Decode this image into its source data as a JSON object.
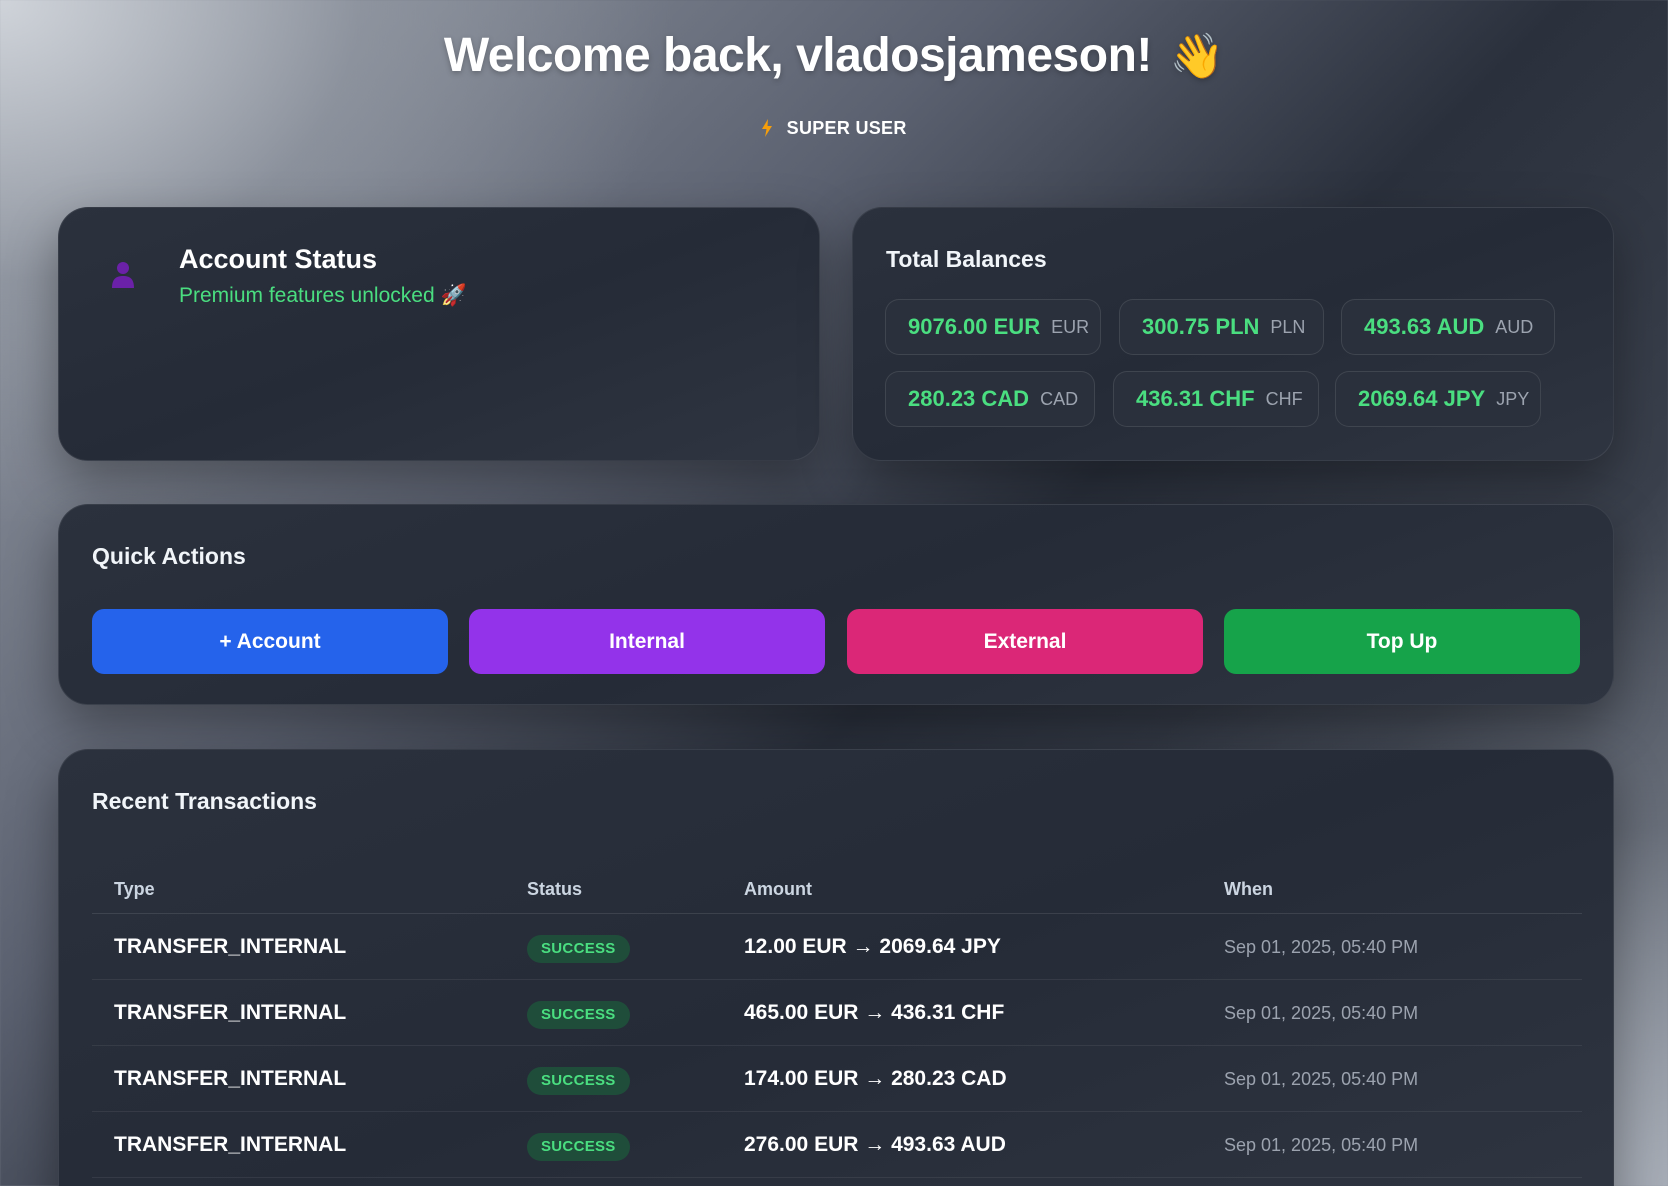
{
  "header": {
    "welcome": "Welcome back, vladosjameson!",
    "wave_emoji": "👋",
    "role_icon": "lightning-bolt-icon",
    "role": "SUPER USER"
  },
  "account_status": {
    "icon": "user-icon",
    "title": "Account Status",
    "subtitle": "Premium features unlocked 🚀"
  },
  "balances": {
    "title": "Total Balances",
    "items": [
      {
        "amount": "9076.00 EUR",
        "currency": "EUR"
      },
      {
        "amount": "300.75 PLN",
        "currency": "PLN"
      },
      {
        "amount": "493.63 AUD",
        "currency": "AUD"
      },
      {
        "amount": "280.23 CAD",
        "currency": "CAD"
      },
      {
        "amount": "436.31 CHF",
        "currency": "CHF"
      },
      {
        "amount": "2069.64 JPY",
        "currency": "JPY"
      }
    ]
  },
  "quick_actions": {
    "title": "Quick Actions",
    "buttons": [
      {
        "label": "+ Account",
        "color": "#2563eb"
      },
      {
        "label": "Internal",
        "color": "#9333ea"
      },
      {
        "label": "External",
        "color": "#db2777"
      },
      {
        "label": "Top Up",
        "color": "#16a34a"
      }
    ]
  },
  "transactions": {
    "title": "Recent Transactions",
    "columns": [
      "Type",
      "Status",
      "Amount",
      "When"
    ],
    "rows": [
      {
        "type": "TRANSFER_INTERNAL",
        "status": "SUCCESS",
        "amount": "12.00 EUR → 2069.64 JPY",
        "when": "Sep 01, 2025, 05:40 PM"
      },
      {
        "type": "TRANSFER_INTERNAL",
        "status": "SUCCESS",
        "amount": "465.00 EUR → 436.31 CHF",
        "when": "Sep 01, 2025, 05:40 PM"
      },
      {
        "type": "TRANSFER_INTERNAL",
        "status": "SUCCESS",
        "amount": "174.00 EUR → 280.23 CAD",
        "when": "Sep 01, 2025, 05:40 PM"
      },
      {
        "type": "TRANSFER_INTERNAL",
        "status": "SUCCESS",
        "amount": "276.00 EUR → 493.63 AUD",
        "when": "Sep 01, 2025, 05:40 PM"
      }
    ]
  },
  "colors": {
    "accent_green": "#4ade80",
    "card_bg": "#262c38",
    "status_badge_bg": "#1f4d3a"
  }
}
